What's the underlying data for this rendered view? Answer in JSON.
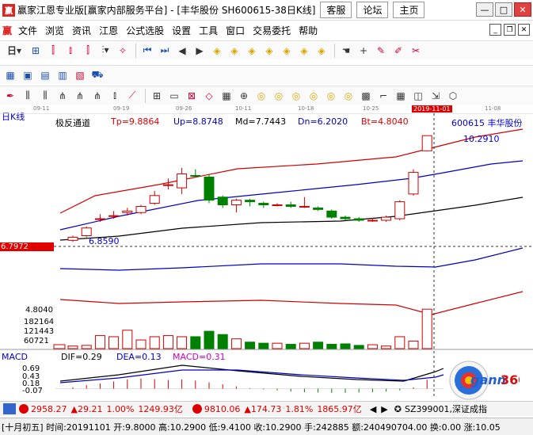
{
  "window": {
    "title": "赢家江恩专业版[赢家内部服务平台] - [丰华股份   SH600615-38日K线]",
    "tabs": [
      "客服",
      "论坛",
      "主页"
    ]
  },
  "menu": {
    "logo": "赢",
    "items": [
      "文件",
      "浏览",
      "资讯",
      "江恩",
      "公式选股",
      "设置",
      "工具",
      "窗口",
      "交易委托",
      "帮助"
    ]
  },
  "toolbar": {
    "period_label": "日"
  },
  "dates": [
    "09-11",
    "09-19",
    "09-26",
    "10-11",
    "10-18",
    "10-25",
    "2019-11-01",
    "11-08"
  ],
  "chart": {
    "period": "日K线",
    "indicator_name": "极反通道",
    "tp_label": "Tp=9.8864",
    "up_label": "Up=8.8748",
    "md_label": "Md=7.7443",
    "dn_label": "Dn=6.2020",
    "bt_label": "Bt=4.8040",
    "stock_label": "600615  丰华股份",
    "high_label": "10.2910",
    "low_label": "6.8590",
    "cursor_price": "6.7972",
    "vol_top": "4.8040",
    "vol_ticks": [
      "182164",
      "121443",
      "60721"
    ]
  },
  "macd": {
    "name": "MACD",
    "dif": "DIF=0.29",
    "dea": "DEA=0.13",
    "macd": "MACD=0.31",
    "ticks": [
      "0.69",
      "0.43",
      "0.18",
      "-0.07"
    ]
  },
  "chart_data": {
    "type": "candlestick",
    "candles": [
      {
        "o": 6.9,
        "c": 7.0,
        "h": 7.05,
        "l": 6.85,
        "up": true
      },
      {
        "o": 7.05,
        "c": 7.3,
        "h": 7.35,
        "l": 7.0,
        "up": true
      },
      {
        "o": 7.6,
        "c": 7.6,
        "h": 7.75,
        "l": 7.5,
        "up": true
      },
      {
        "o": 7.7,
        "c": 7.7,
        "h": 7.85,
        "l": 7.6,
        "up": true
      },
      {
        "o": 7.8,
        "c": 7.85,
        "h": 7.95,
        "l": 7.7,
        "up": true
      },
      {
        "o": 7.8,
        "c": 8.0,
        "h": 8.05,
        "l": 7.75,
        "up": true
      },
      {
        "o": 8.1,
        "c": 8.35,
        "h": 8.5,
        "l": 8.05,
        "up": true
      },
      {
        "o": 8.7,
        "c": 8.7,
        "h": 8.9,
        "l": 8.55,
        "up": true
      },
      {
        "o": 8.6,
        "c": 9.05,
        "h": 9.25,
        "l": 8.4,
        "up": true
      },
      {
        "o": 9.0,
        "c": 9.0,
        "h": 9.2,
        "l": 8.95,
        "up": false
      },
      {
        "o": 8.95,
        "c": 8.2,
        "h": 9.05,
        "l": 8.1,
        "up": false
      },
      {
        "o": 8.3,
        "c": 8.05,
        "h": 8.35,
        "l": 7.95,
        "up": false
      },
      {
        "o": 8.05,
        "c": 8.2,
        "h": 8.25,
        "l": 7.8,
        "up": true
      },
      {
        "o": 8.2,
        "c": 8.15,
        "h": 8.25,
        "l": 8.0,
        "up": false
      },
      {
        "o": 8.1,
        "c": 8.05,
        "h": 8.15,
        "l": 7.95,
        "up": false
      },
      {
        "o": 8.05,
        "c": 8.05,
        "h": 8.1,
        "l": 8.0,
        "up": true
      },
      {
        "o": 8.05,
        "c": 8.0,
        "h": 8.15,
        "l": 7.95,
        "up": false
      },
      {
        "o": 8.0,
        "c": 8.0,
        "h": 8.3,
        "l": 7.95,
        "up": true
      },
      {
        "o": 7.95,
        "c": 7.9,
        "h": 8.0,
        "l": 7.85,
        "up": false
      },
      {
        "o": 7.85,
        "c": 7.65,
        "h": 7.9,
        "l": 7.6,
        "up": false
      },
      {
        "o": 7.65,
        "c": 7.6,
        "h": 7.7,
        "l": 7.55,
        "up": false
      },
      {
        "o": 7.6,
        "c": 7.55,
        "h": 7.65,
        "l": 7.5,
        "up": false
      },
      {
        "o": 7.55,
        "c": 7.55,
        "h": 7.6,
        "l": 7.5,
        "up": true
      },
      {
        "o": 7.55,
        "c": 7.65,
        "h": 7.7,
        "l": 7.5,
        "up": true
      },
      {
        "o": 7.6,
        "c": 8.15,
        "h": 8.2,
        "l": 7.55,
        "up": true
      },
      {
        "o": 8.4,
        "c": 9.1,
        "h": 9.2,
        "l": 8.35,
        "up": true
      },
      {
        "o": 9.8,
        "c": 10.29,
        "h": 10.29,
        "l": 9.8,
        "up": true
      }
    ],
    "bands": {
      "tp": [
        8.3,
        9.88
      ],
      "up": [
        7.75,
        8.87
      ],
      "md": [
        7.25,
        7.74
      ],
      "dn": [
        6.85,
        6.2
      ],
      "bt": [
        5.5,
        4.8
      ]
    },
    "volumes": [
      12,
      15,
      60,
      55,
      85,
      40,
      55,
      60,
      55,
      55,
      80,
      65,
      45,
      30,
      25,
      25,
      20,
      25,
      30,
      20,
      22,
      15,
      18,
      12,
      55,
      35,
      182
    ]
  },
  "status": {
    "sh_index": "2958.27",
    "sh_change": "▲29.21",
    "sh_pct": "1.00%",
    "sh_amount": "1249.93亿",
    "sz_index": "9810.06",
    "sz_change": "▲174.73",
    "sz_pct": "1.81%",
    "sz_amount": "1865.97亿",
    "sz_code": "SZ399001,深证成指"
  },
  "quote": {
    "text": "[十月初五] 时间:20191101 开:9.8000 高:10.2900 低:9.4100 收:10.2900 手:242885 额:240490704.00 换:0.00 涨:10.05"
  }
}
